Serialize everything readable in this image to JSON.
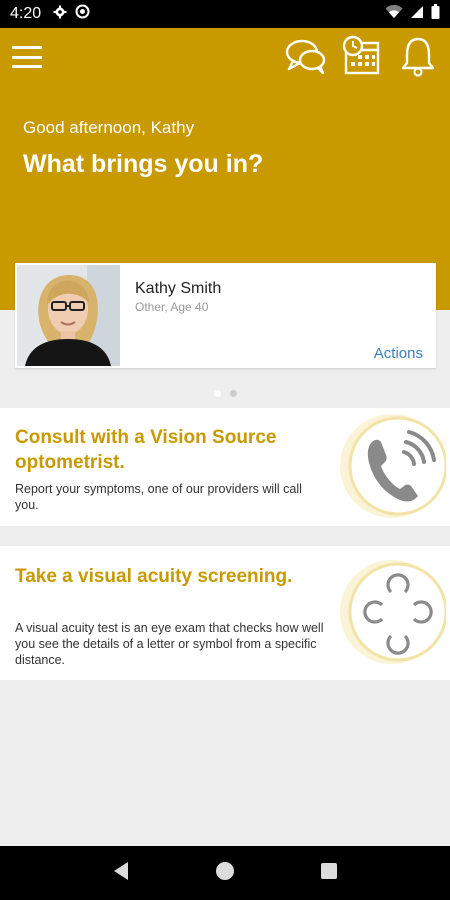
{
  "status": {
    "time": "4:20"
  },
  "header": {
    "greeting": "Good afternoon, Kathy",
    "headline": "What brings you in?"
  },
  "profile": {
    "name": "Kathy Smith",
    "details": "Other, Age 40",
    "actions_label": "Actions"
  },
  "carousel": {
    "pages": 2,
    "active": 0
  },
  "options": [
    {
      "title": "Consult with a Vision Source optometrist.",
      "description": "Report your symptoms, one of our providers will call you.",
      "icon": "phone-icon"
    },
    {
      "title": "Take a visual acuity screening.",
      "description": "A visual acuity test is an eye exam that checks how well you see the details of a letter or symbol from a specific distance.",
      "icon": "landolt-c-icon"
    }
  ],
  "colors": {
    "brand": "#c89a00",
    "link": "#3a7fc1",
    "icon_ring": "#f5e8b8"
  }
}
